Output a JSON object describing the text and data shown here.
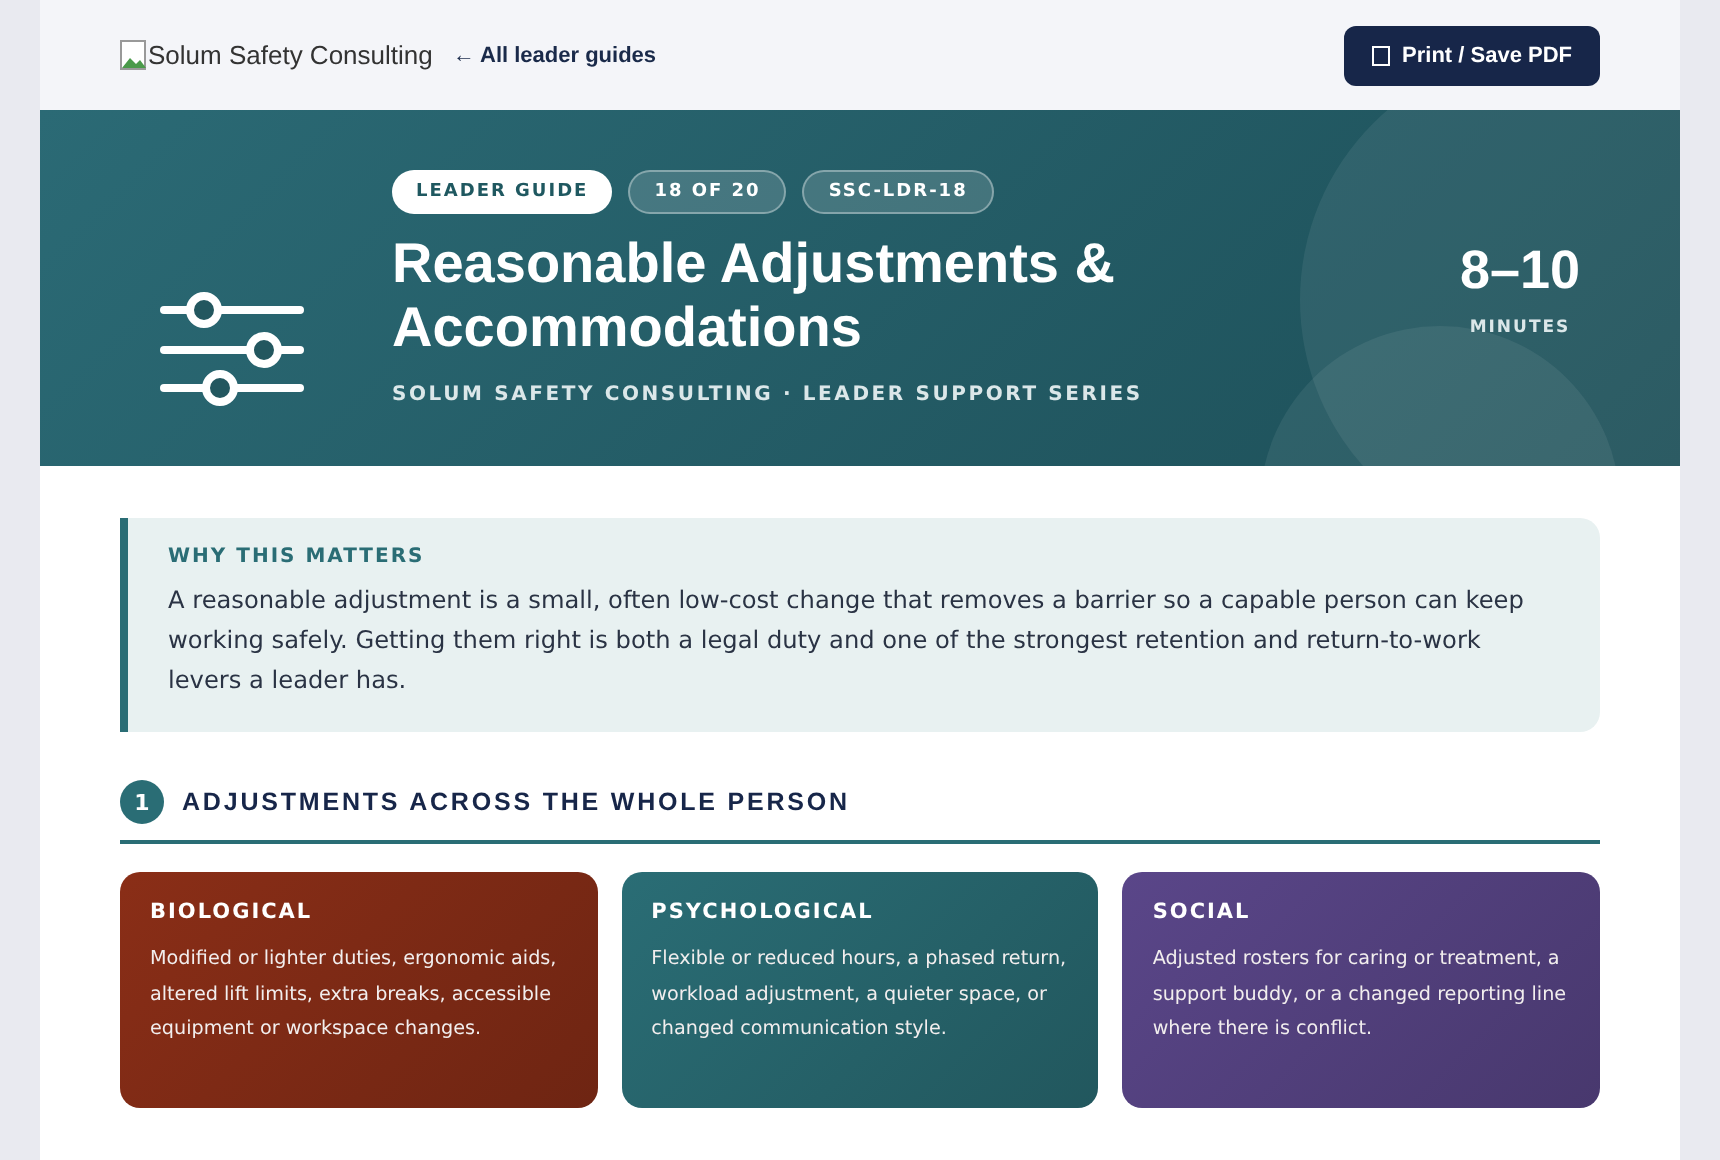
{
  "header": {
    "logo_alt": "Solum Safety Consulting",
    "back_link": "← All leader guides",
    "print_button": "Print / Save PDF"
  },
  "hero": {
    "badges": [
      {
        "label": "LEADER GUIDE",
        "kind": "solid"
      },
      {
        "label": "18 OF 20",
        "kind": "outline"
      },
      {
        "label": "SSC-LDR-18",
        "kind": "outline"
      }
    ],
    "title": "Reasonable Adjustments & Accommodations",
    "subtitle": "SOLUM SAFETY CONSULTING · LEADER SUPPORT SERIES",
    "duration": "8–10",
    "duration_unit": "MINUTES"
  },
  "callout": {
    "heading": "WHY THIS MATTERS",
    "text": "A reasonable adjustment is a small, often low-cost change that removes a barrier so a capable person can keep working safely. Getting them right is both a legal duty and one of the strongest retention and return-to-work levers a leader has."
  },
  "section": {
    "number": "1",
    "title": "ADJUSTMENTS ACROSS THE WHOLE PERSON",
    "cards": [
      {
        "title": "BIOLOGICAL",
        "text": "Modified or lighter duties, ergonomic aids, altered lift limits, extra breaks, accessible equipment or workspace changes.",
        "color": "#8a2e17"
      },
      {
        "title": "PSYCHOLOGICAL",
        "text": "Flexible or reduced hours, a phased return, workload adjustment, a quieter space, or changed communication style.",
        "color": "#2a6d75"
      },
      {
        "title": "SOCIAL",
        "text": "Adjusted rosters for caring or treatment, a support buddy, or a changed reporting line where there is conflict.",
        "color": "#5a4689"
      }
    ]
  }
}
